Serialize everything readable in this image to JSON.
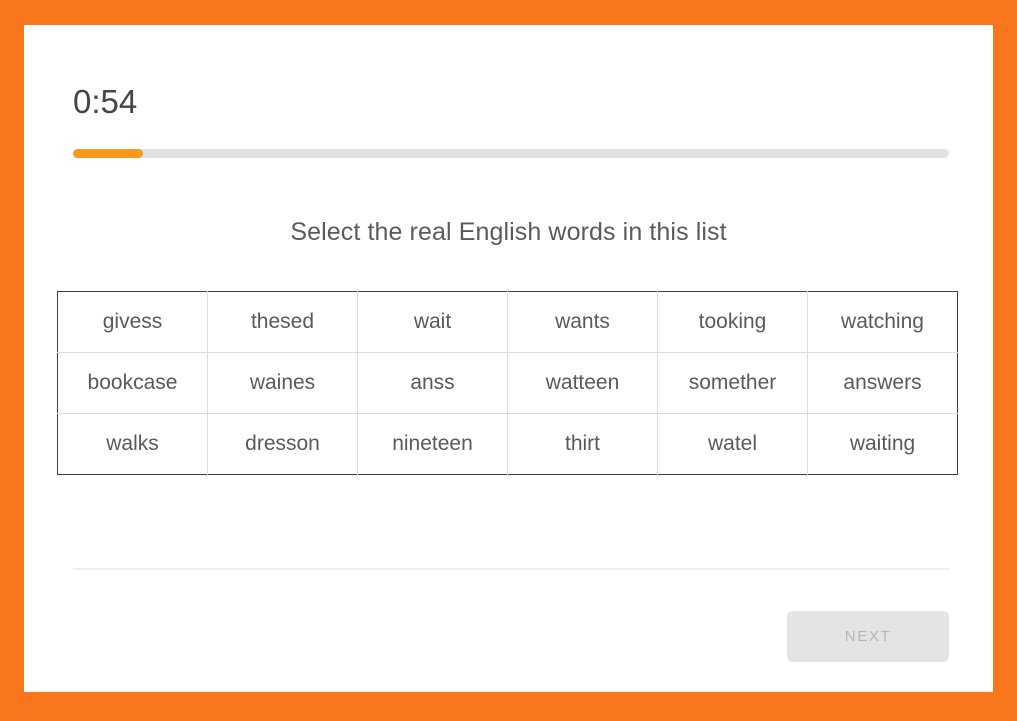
{
  "theme": {
    "border_color": "#f9761c",
    "progress_color": "#f9971e",
    "card_background": "#ffffff",
    "text_color": "#5a5a5a"
  },
  "header": {
    "timer": "0:54",
    "progress_percent": 8
  },
  "main": {
    "prompt": "Select the real English words in this list",
    "word_grid": {
      "rows": [
        [
          "givess",
          "thesed",
          "wait",
          "wants",
          "tooking",
          "watching"
        ],
        [
          "bookcase",
          "waines",
          "anss",
          "watteen",
          "somether",
          "answers"
        ],
        [
          "walks",
          "dresson",
          "nineteen",
          "thirt",
          "watel",
          "waiting"
        ]
      ]
    }
  },
  "footer": {
    "next_label": "Next"
  }
}
